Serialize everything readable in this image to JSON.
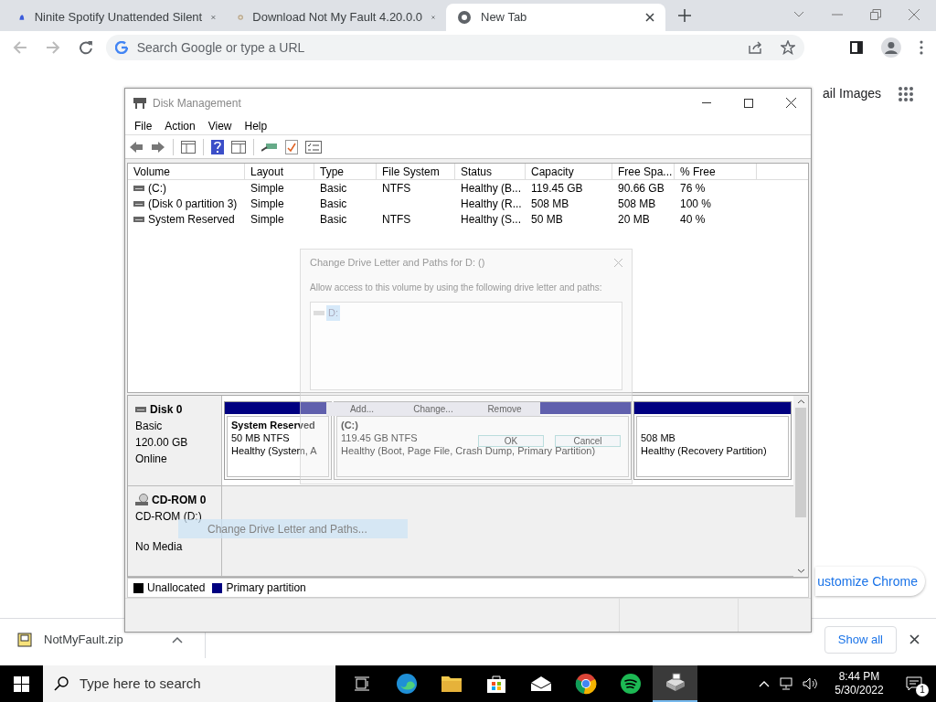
{
  "browser": {
    "tabs": [
      {
        "title": "Ninite Spotify Unattended Silent",
        "selected": false
      },
      {
        "title": "Download Not My Fault 4.20.0.0",
        "selected": false
      },
      {
        "title": "New Tab",
        "selected": true
      }
    ],
    "omnibox": {
      "placeholder": "Search Google or type a URL"
    }
  },
  "page": {
    "links": [
      "ail",
      "Images"
    ],
    "customize": "ustomize Chrome"
  },
  "disk_management": {
    "title": "Disk Management",
    "menu": [
      "File",
      "Action",
      "View",
      "Help"
    ],
    "columns": [
      "Volume",
      "Layout",
      "Type",
      "File System",
      "Status",
      "Capacity",
      "Free Spa...",
      "% Free"
    ],
    "rows": [
      [
        "(C:)",
        "Simple",
        "Basic",
        "NTFS",
        "Healthy (B...",
        "119.45 GB",
        "90.66 GB",
        "76 %"
      ],
      [
        "(Disk 0 partition 3)",
        "Simple",
        "Basic",
        "",
        "Healthy (R...",
        "508 MB",
        "508 MB",
        "100 %"
      ],
      [
        "System Reserved",
        "Simple",
        "Basic",
        "NTFS",
        "Healthy (S...",
        "50 MB",
        "20 MB",
        "40 %"
      ]
    ],
    "disks": [
      {
        "kind": "disk",
        "name": "Disk 0",
        "lines": [
          "Basic",
          "120.00 GB",
          "Online"
        ],
        "partitions": [
          {
            "title": "System Reserved",
            "bold": true,
            "lines": [
              "50 MB NTFS",
              "Healthy (System, A"
            ]
          },
          {
            "title": "(C:)",
            "bold": true,
            "lines": [
              "119.45 GB NTFS",
              "Healthy (Boot, Page File, Crash Dump, Primary Partition)"
            ]
          },
          {
            "lines": [
              "508 MB",
              "Healthy (Recovery Partition)"
            ]
          }
        ]
      },
      {
        "kind": "cdrom",
        "name": "CD-ROM 0",
        "lines": [
          "CD-ROM (D:)",
          "No Media"
        ]
      }
    ],
    "legend": [
      {
        "label": "Unallocated",
        "color": "#000000"
      },
      {
        "label": "Primary partition",
        "color": "#000080"
      }
    ],
    "context_menu": [
      {
        "label": "Change Drive Letter and Paths...",
        "selected": true
      }
    ]
  },
  "dialog": {
    "title": "Change Drive Letter and Paths for D: ()",
    "description": "Allow access to this volume by using the following drive letter and paths:",
    "paths": [
      {
        "label": "D:",
        "selected": true
      }
    ],
    "buttons": [
      "Add...",
      "Change...",
      "Remove"
    ],
    "confirm_buttons": [
      "OK",
      "Cancel"
    ]
  },
  "downloads": {
    "file": "NotMyFault.zip",
    "show_all": "Show all"
  },
  "taskbar": {
    "search_placeholder": "Type here to search",
    "apps": [
      {
        "active": false
      },
      {
        "active": false
      },
      {
        "active": false
      },
      {
        "active": false
      },
      {
        "active": false
      },
      {
        "active": false
      },
      {
        "active": false
      },
      {
        "active": true
      }
    ],
    "time": "8:44 PM",
    "date": "5/30/2022",
    "notifications": "1"
  }
}
